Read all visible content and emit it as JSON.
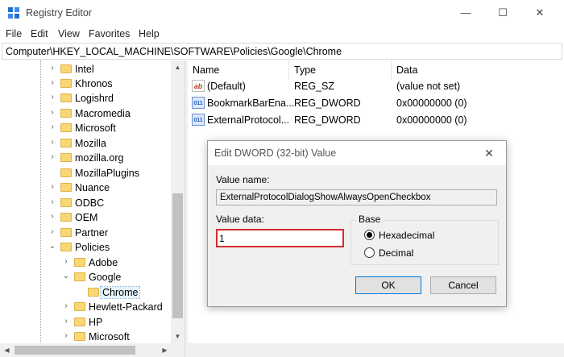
{
  "window": {
    "title": "Registry Editor",
    "minimize_glyph": "—",
    "maximize_glyph": "☐",
    "close_glyph": "✕"
  },
  "menu": [
    "File",
    "Edit",
    "View",
    "Favorites",
    "Help"
  ],
  "address": "Computer\\HKEY_LOCAL_MACHINE\\SOFTWARE\\Policies\\Google\\Chrome",
  "tree": {
    "items": [
      {
        "label": "Intel",
        "chevron": "›"
      },
      {
        "label": "Khronos",
        "chevron": "›"
      },
      {
        "label": "Logishrd",
        "chevron": "›"
      },
      {
        "label": "Macromedia",
        "chevron": "›"
      },
      {
        "label": "Microsoft",
        "chevron": "›"
      },
      {
        "label": "Mozilla",
        "chevron": "›"
      },
      {
        "label": "mozilla.org",
        "chevron": "›"
      },
      {
        "label": "MozillaPlugins",
        "chevron": ""
      },
      {
        "label": "Nuance",
        "chevron": "›"
      },
      {
        "label": "ODBC",
        "chevron": "›"
      },
      {
        "label": "OEM",
        "chevron": "›"
      },
      {
        "label": "Partner",
        "chevron": "›"
      },
      {
        "label": "Policies",
        "chevron": "⌄"
      },
      {
        "label": "Adobe",
        "chevron": "›"
      },
      {
        "label": "Google",
        "chevron": "⌄"
      },
      {
        "label": "Chrome",
        "chevron": ""
      },
      {
        "label": "Hewlett-Packard",
        "chevron": "›"
      },
      {
        "label": "HP",
        "chevron": "›"
      },
      {
        "label": "Microsoft",
        "chevron": "›"
      }
    ],
    "selected": "Chrome"
  },
  "list": {
    "columns": [
      "Name",
      "Type",
      "Data"
    ],
    "rows": [
      {
        "icon": "string-value-icon",
        "icon_glyph": "ab",
        "name": "(Default)",
        "type": "REG_SZ",
        "data": "(value not set)"
      },
      {
        "icon": "dword-value-icon",
        "icon_glyph": "011",
        "name": "BookmarkBarEna...",
        "type": "REG_DWORD",
        "data": "0x00000000 (0)"
      },
      {
        "icon": "dword-value-icon",
        "icon_glyph": "011",
        "name": "ExternalProtocol...",
        "type": "REG_DWORD",
        "data": "0x00000000 (0)"
      }
    ]
  },
  "dialog": {
    "title": "Edit DWORD (32-bit) Value",
    "close_glyph": "✕",
    "value_name_label": "Value name:",
    "value_name": "ExternalProtocolDialogShowAlwaysOpenCheckbox",
    "value_data_label": "Value data:",
    "value_data": "1",
    "base_label": "Base",
    "hex_label": "Hexadecimal",
    "dec_label": "Decimal",
    "base_selected": "Hexadecimal",
    "ok_label": "OK",
    "cancel_label": "Cancel",
    "highlight_color": "#d62b2b"
  },
  "scroll": {
    "up_glyph": "▲",
    "down_glyph": "▼",
    "left_glyph": "◀",
    "right_glyph": "▶"
  }
}
